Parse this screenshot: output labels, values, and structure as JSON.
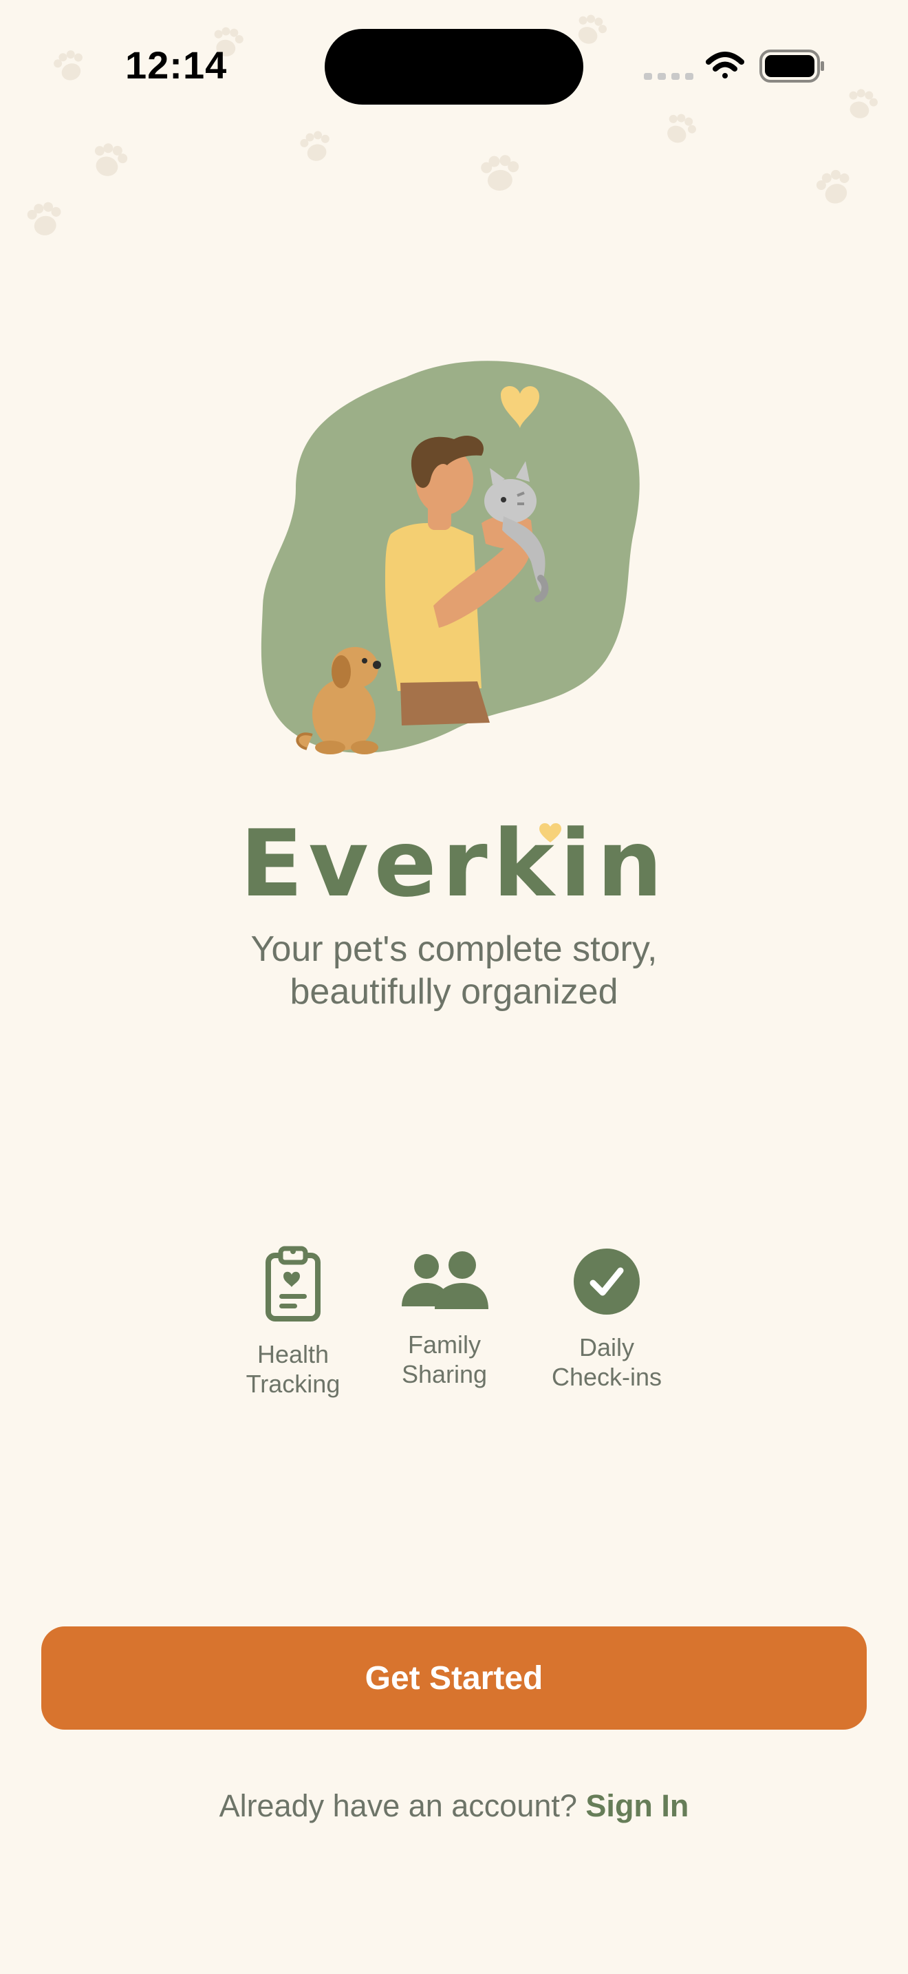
{
  "status_bar": {
    "time": "12:14"
  },
  "brand": {
    "name": "Everkin",
    "tagline_line1": "Your pet's complete story,",
    "tagline_line2": "beautifully organized"
  },
  "features": [
    {
      "label": "Health\nTracking",
      "icon": "clipboard-heart-icon"
    },
    {
      "label": "Family\nSharing",
      "icon": "people-icon"
    },
    {
      "label": "Daily\nCheck-ins",
      "icon": "check-circle-icon"
    }
  ],
  "actions": {
    "get_started_label": "Get Started",
    "signin_prompt": "Already have an account?",
    "signin_label": "Sign In"
  },
  "colors": {
    "background": "#fcf7ee",
    "brand_green": "#667d58",
    "accent_orange": "#d8742e",
    "muted_text": "#6d7468",
    "illustration_green": "#9caf88",
    "heart_yellow": "#f7d27a"
  }
}
